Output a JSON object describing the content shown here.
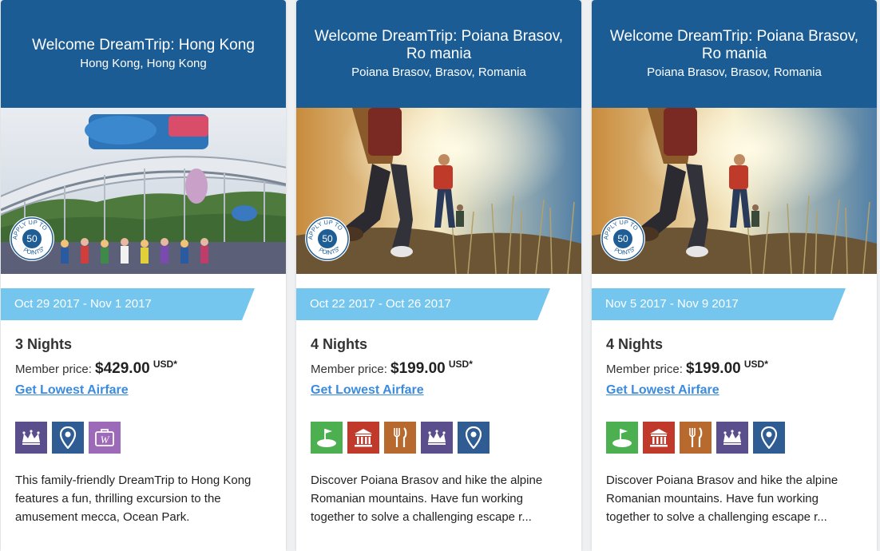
{
  "badge": {
    "apply_text": "APPLY UP TO",
    "points_text": "POINTS*"
  },
  "cards": [
    {
      "title": "Welcome DreamTrip: Hong Kong",
      "location": "Hong Kong, Hong Kong",
      "image": "ocean-park-entrance-photo",
      "points": "50",
      "dates": "Oct 29 2017 - Nov 1 2017",
      "nights": "3 Nights",
      "price_label": "Member price:",
      "price": "$429.00",
      "currency": "USD*",
      "airfare_link": "Get Lowest Airfare",
      "amenities": [
        {
          "name": "crown-icon",
          "color": "#5a4f8c"
        },
        {
          "name": "map-pin-icon",
          "color": "#2f5d93"
        },
        {
          "name": "wedding-icon",
          "color": "#9c6ab8"
        }
      ],
      "description": "This family-friendly DreamTrip to Hong Kong features a fun, thrilling excursion to the amusement mecca, Ocean Park."
    },
    {
      "title": "Welcome DreamTrip: Poiana Brasov, Ro mania",
      "location": "Poiana Brasov, Brasov, Romania",
      "image": "hikers-mountain-photo",
      "points": "50",
      "dates": "Oct 22 2017 - Oct 26 2017",
      "nights": "4 Nights",
      "price_label": "Member price:",
      "price": "$199.00",
      "currency": "USD*",
      "airfare_link": "Get Lowest Airfare",
      "amenities": [
        {
          "name": "golf-icon",
          "color": "#4caf50"
        },
        {
          "name": "museum-icon",
          "color": "#c0392b"
        },
        {
          "name": "dining-icon",
          "color": "#b8692e"
        },
        {
          "name": "crown-icon",
          "color": "#5a4f8c"
        },
        {
          "name": "map-pin-icon",
          "color": "#2f5d93"
        }
      ],
      "description": "Discover Poiana Brasov and hike the alpine Romanian mountains. Have fun working together to solve a challenging escape r..."
    },
    {
      "title": "Welcome DreamTrip: Poiana Brasov, Ro mania",
      "location": "Poiana Brasov, Brasov, Romania",
      "image": "hikers-mountain-photo",
      "points": "50",
      "dates": "Nov 5 2017 - Nov 9 2017",
      "nights": "4 Nights",
      "price_label": "Member price:",
      "price": "$199.00",
      "currency": "USD*",
      "airfare_link": "Get Lowest Airfare",
      "amenities": [
        {
          "name": "golf-icon",
          "color": "#4caf50"
        },
        {
          "name": "museum-icon",
          "color": "#c0392b"
        },
        {
          "name": "dining-icon",
          "color": "#b8692e"
        },
        {
          "name": "crown-icon",
          "color": "#5a4f8c"
        },
        {
          "name": "map-pin-icon",
          "color": "#2f5d93"
        }
      ],
      "description": "Discover Poiana Brasov and hike the alpine Romanian mountains. Have fun working together to solve a challenging escape r..."
    }
  ]
}
